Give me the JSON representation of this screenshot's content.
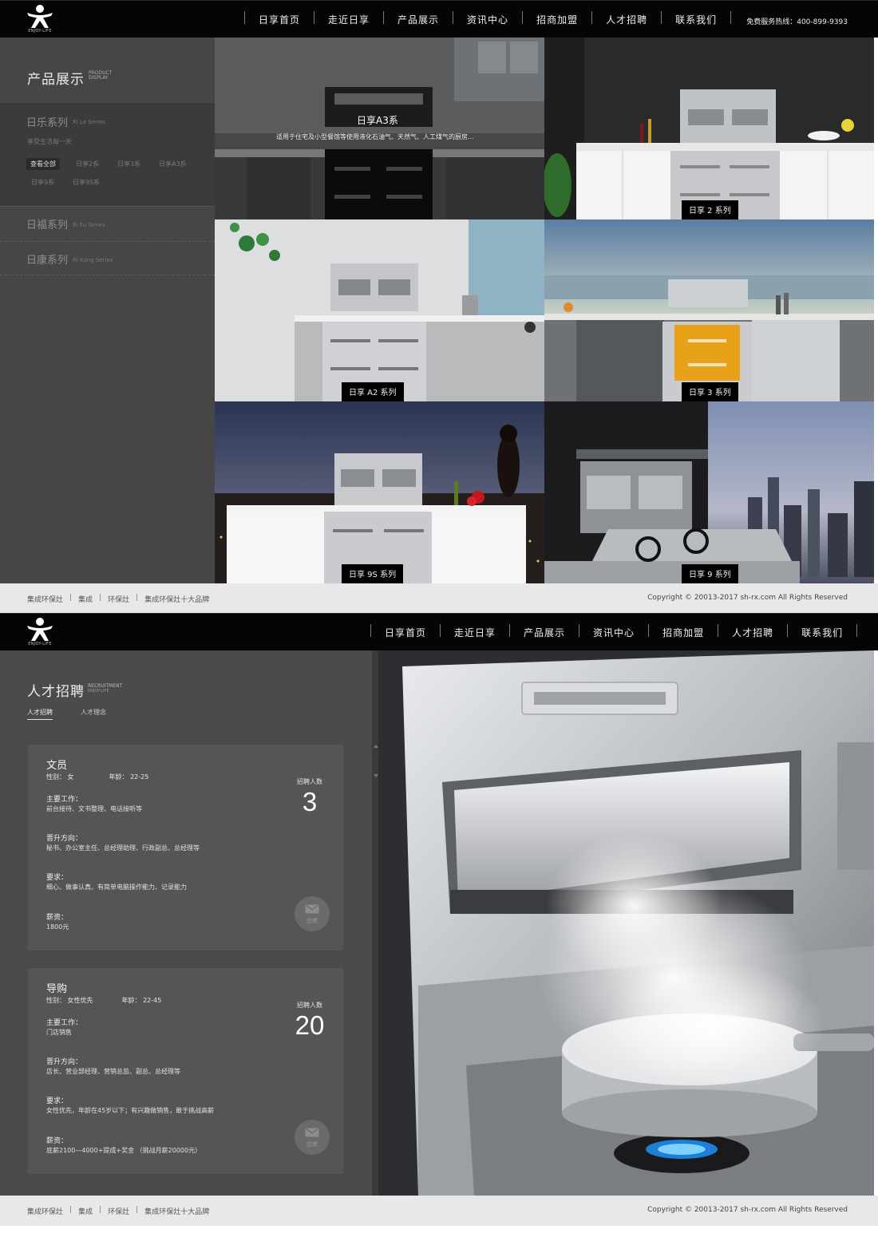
{
  "brand": {
    "logo_text": "ENJOY-LIFE"
  },
  "nav": [
    "日享首页",
    "走近日享",
    "产品展示",
    "资讯中心",
    "招商加盟",
    "人才招聘",
    "联系我们"
  ],
  "hotline": "免费服务热线：400-899-9393",
  "products_page": {
    "title": "产品展示",
    "title_en": [
      "PRODUCT",
      "DISPLAY"
    ],
    "series": [
      {
        "name": "日乐系列",
        "en": "Ri Le Series",
        "desc": "享受生活每一天",
        "chips": [
          "查看全部",
          "日享2系",
          "日享3系",
          "日享A3系",
          "日享9系",
          "日享9S系"
        ],
        "active_chip": "查看全部"
      },
      {
        "name": "日福系列",
        "en": "Ri Fu Series"
      },
      {
        "name": "日康系列",
        "en": "Ri Kang Series"
      }
    ],
    "featured": {
      "title": "日享A3系",
      "desc": "适用于住宅及小型餐馆等使用液化石油气、天然气、人工煤气的厨房..."
    },
    "tiles": [
      "日享 2 系列",
      "日享 A2 系列",
      "日享 3 系列",
      "日享 9S 系列",
      "日享 9 系列"
    ]
  },
  "footer": {
    "links": [
      "集成环保灶",
      "集成",
      "环保灶",
      "集成环保灶十大品牌"
    ],
    "copyright": "Copyright © 20013-2017 sh-rx.com All Rights Reserved"
  },
  "recruit_page": {
    "title": "人才招聘",
    "title_en": [
      "RECRUITMENT",
      "ENJOY-LIFE"
    ],
    "tabs": [
      "人才招聘",
      "人才理念"
    ],
    "active_tab": "人才招聘",
    "hire_label": "招聘人数",
    "apply_label": "应聘",
    "jobs": [
      {
        "title": "文员",
        "gender": "性别： 女",
        "age": "年龄： 22-25",
        "count": "3",
        "duty_label": "主要工作：",
        "duty": "前台接待、文书整理、电话接听等",
        "promo_label": "晋升方向：",
        "promo": "秘书、办公室主任、总经理助理、行政副总、总经理等",
        "req_label": "要求：",
        "req": "细心、做事认真、有简单电脑操作能力、记录能力",
        "salary_label": "薪资：",
        "salary": "1800元"
      },
      {
        "title": "导购",
        "gender": "性别： 女性优先",
        "age": "年龄： 22-45",
        "count": "20",
        "duty_label": "主要工作：",
        "duty": "门店销售",
        "promo_label": "晋升方向：",
        "promo": "店长、营业部经理、营销总监、副总、总经理等",
        "req_label": "要求：",
        "req": "女性优先，年龄在45岁以下；有兴趣做销售，敢于挑战高薪",
        "salary_label": "薪资：",
        "salary": "底薪2100—4000+提成+奖金 （挑战月薪20000元）"
      }
    ]
  },
  "colors": {
    "header_bg": "#050505",
    "sidebar_bg": "#464646",
    "card_bg": "#555555",
    "footer_bg": "#e8e8ea",
    "accent_orange": "#e8a21a"
  }
}
